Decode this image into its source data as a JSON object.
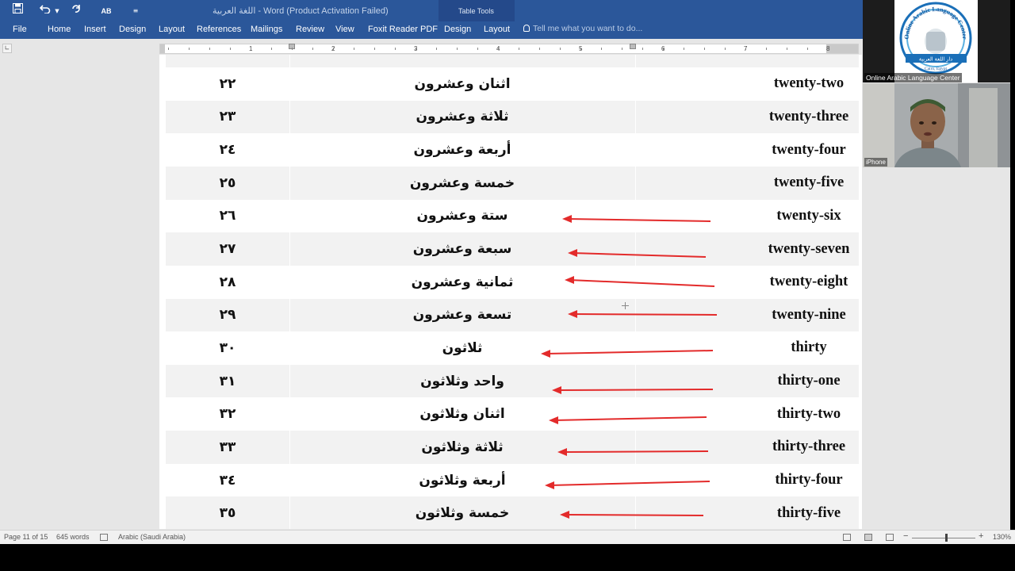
{
  "window": {
    "title": "اللغة العربية - Word (Product Activation Failed)",
    "table_tools_label": "Table Tools",
    "qat": {
      "autoformat_label": "AB"
    }
  },
  "ribbon": {
    "tabs": [
      "File",
      "Home",
      "Insert",
      "Design",
      "Layout",
      "References",
      "Mailings",
      "Review",
      "View",
      "Foxit Reader PDF",
      "Design",
      "Layout"
    ],
    "tell_me_placeholder": "Tell me what you want to do..."
  },
  "ruler": {
    "numbers": [
      "1",
      "2",
      "3",
      "4",
      "5",
      "6",
      "7",
      "8"
    ]
  },
  "document": {
    "rows": [
      {
        "num": "٢٢",
        "arabic": "اثنان وعشرون",
        "english": "twenty-two"
      },
      {
        "num": "٢٣",
        "arabic": "ثلاثة وعشرون",
        "english": "twenty-three"
      },
      {
        "num": "٢٤",
        "arabic": "أربعة وعشرون",
        "english": "twenty-four"
      },
      {
        "num": "٢٥",
        "arabic": "خمسة وعشرون",
        "english": "twenty-five"
      },
      {
        "num": "٢٦",
        "arabic": "ستة وعشرون",
        "english": "twenty-six"
      },
      {
        "num": "٢٧",
        "arabic": "سبعة وعشرون",
        "english": "twenty-seven"
      },
      {
        "num": "٢٨",
        "arabic": "ثمانية وعشرون",
        "english": "twenty-eight"
      },
      {
        "num": "٢٩",
        "arabic": "تسعة وعشرون",
        "english": "twenty-nine"
      },
      {
        "num": "٣٠",
        "arabic": "ثلاثون",
        "english": "thirty"
      },
      {
        "num": "٣١",
        "arabic": "واحد وثلاثون",
        "english": "thirty-one"
      },
      {
        "num": "٣٢",
        "arabic": "اثنان وثلاثون",
        "english": "thirty-two"
      },
      {
        "num": "٣٣",
        "arabic": "ثلاثة وثلاثون",
        "english": "thirty-three"
      },
      {
        "num": "٣٤",
        "arabic": "أربعة وثلاثون",
        "english": "thirty-four"
      },
      {
        "num": "٣٥",
        "arabic": "خمسة وثلاثون",
        "english": "thirty-five"
      }
    ],
    "annotation_color": "#e32b2b"
  },
  "statusbar": {
    "page": "Page 11 of 15",
    "words": "645 words",
    "language": "Arabic (Saudi Arabia)",
    "zoom": "130%"
  },
  "meeting": {
    "logo_caption": "Online Arabic Language Center",
    "logo_text_top": "Online Arabic Language Center",
    "logo_text_arabic": "دار اللغة العربية",
    "logo_text_bottom": "Cairo, Egypt",
    "camera_caption": "iPhone"
  },
  "colors": {
    "ribbon_blue": "#2b579a",
    "row_shade": "#f2f2f2",
    "arrow_red": "#e32b2b"
  }
}
